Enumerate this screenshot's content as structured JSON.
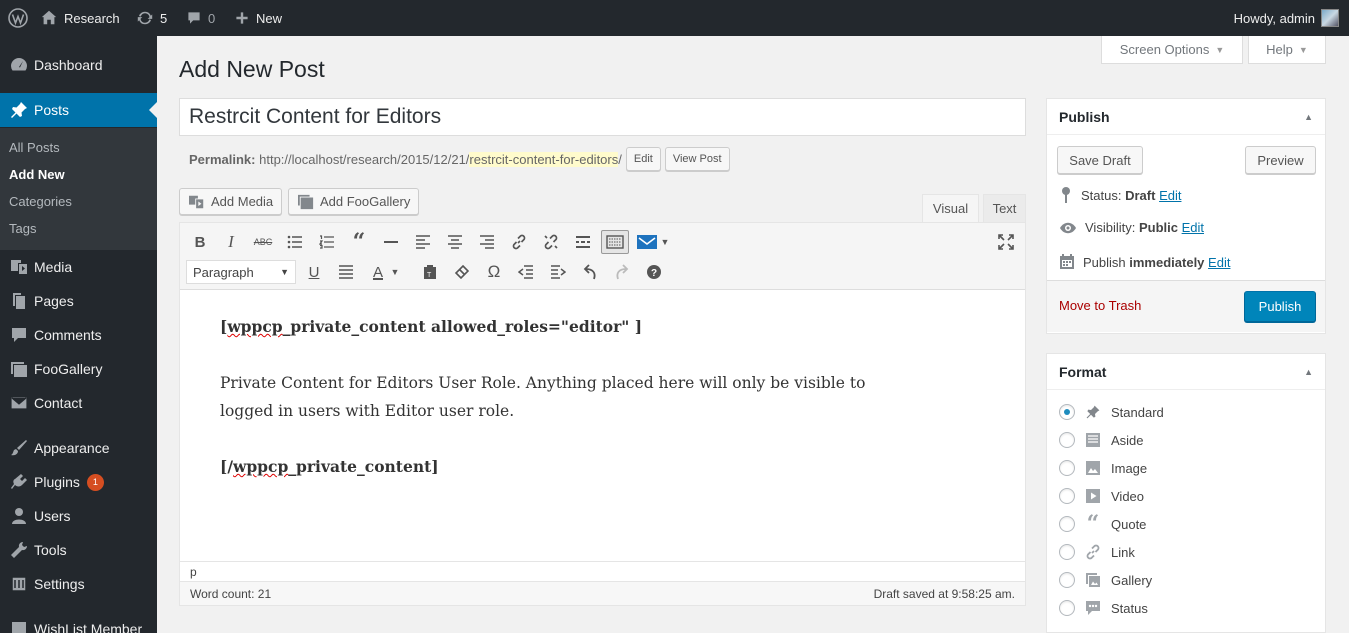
{
  "admin_bar": {
    "site_name": "Research",
    "updates_count": "5",
    "comments_count": "0",
    "new_label": "New",
    "howdy": "Howdy, admin"
  },
  "menu": {
    "dashboard": "Dashboard",
    "posts": "Posts",
    "posts_sub": [
      "All Posts",
      "Add New",
      "Categories",
      "Tags"
    ],
    "media": "Media",
    "pages": "Pages",
    "comments": "Comments",
    "foogallery": "FooGallery",
    "contact": "Contact",
    "appearance": "Appearance",
    "plugins": "Plugins",
    "plugins_badge": "1",
    "users": "Users",
    "tools": "Tools",
    "settings": "Settings",
    "cutoff_item": "WishList Member"
  },
  "screen_meta": {
    "screen_options": "Screen Options",
    "help": "Help"
  },
  "page_title": "Add New Post",
  "post": {
    "title_value": "Restrcit Content for Editors",
    "permalink_label": "Permalink:",
    "permalink_base": "http://localhost/research/2015/12/21/",
    "permalink_slug": "restrcit-content-for-editors",
    "permalink_trailing": "/",
    "edit_btn": "Edit",
    "view_btn": "View Post"
  },
  "media_buttons": {
    "add_media": "Add Media",
    "add_foogallery": "Add FooGallery"
  },
  "editor_tabs": {
    "visual": "Visual",
    "text": "Text"
  },
  "toolbar": {
    "format_select": "Paragraph"
  },
  "content": {
    "shortcode_open": "[wppcp_private_content allowed_roles=\"editor\" ]",
    "paragraph": "Private Content for Editors User Role.  Anything placed here will only be visible to logged in users with Editor user role.",
    "shortcode_close": "[/wppcp_private_content]"
  },
  "editor_status": {
    "path": "p",
    "word_count": "Word count: 21",
    "draft_saved": "Draft saved at 9:58:25 am."
  },
  "publish_box": {
    "title": "Publish",
    "save_draft": "Save Draft",
    "preview": "Preview",
    "status_label": "Status:",
    "status_value": "Draft",
    "visibility_label": "Visibility:",
    "visibility_value": "Public",
    "publish_label": "Publish",
    "publish_value": "immediately",
    "edit_link": "Edit",
    "move_to_trash": "Move to Trash",
    "publish_btn": "Publish"
  },
  "format_box": {
    "title": "Format",
    "options": [
      "Standard",
      "Aside",
      "Image",
      "Video",
      "Quote",
      "Link",
      "Gallery",
      "Status"
    ],
    "selected": "Standard"
  }
}
